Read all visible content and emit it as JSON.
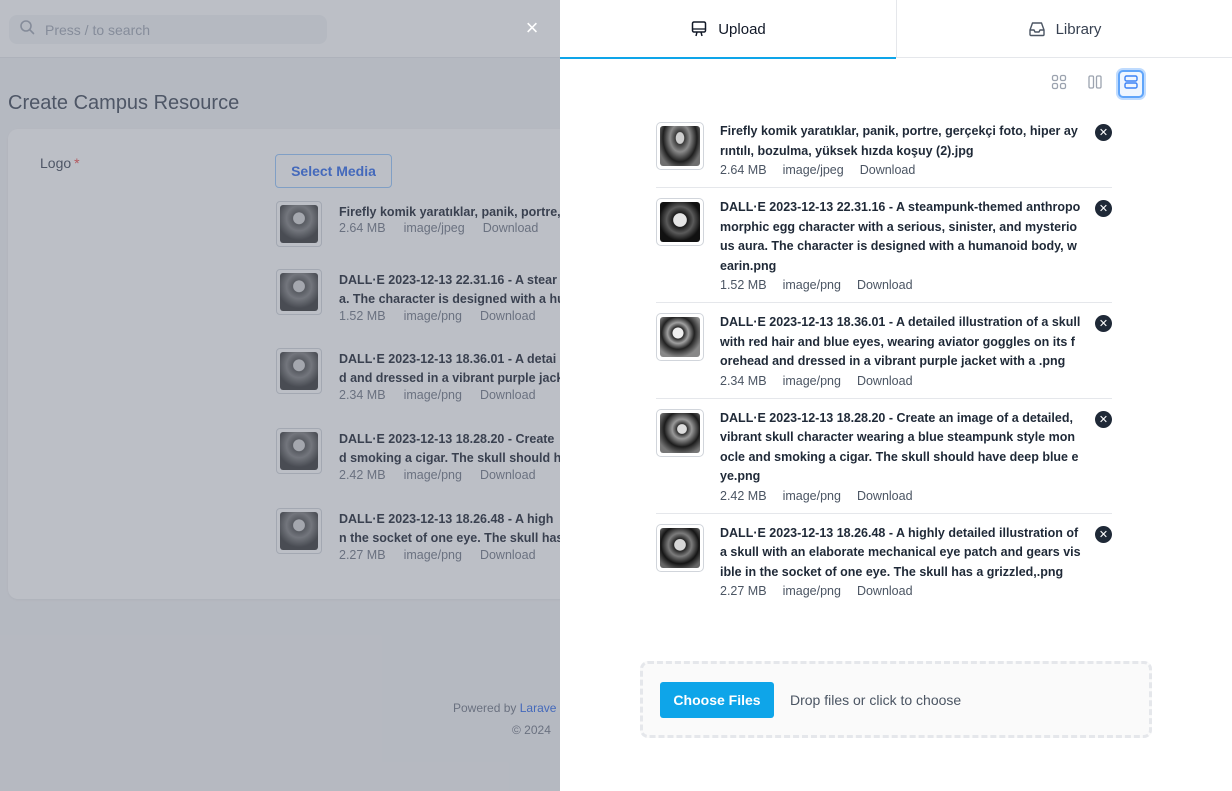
{
  "background": {
    "search_placeholder": "Press / to search",
    "close_label": "×",
    "page_title": "Create Campus Resource",
    "logo_label": "Logo",
    "required_mark": "*",
    "select_media_label": "Select Media",
    "items": [
      {
        "title_line1": "Firefly komik yaratıklar, panik, portre,",
        "title_line2": "",
        "size": "2.64 MB",
        "type": "image/jpeg",
        "download": "Download"
      },
      {
        "title_line1": "DALL·E 2023-12-13 22.31.16 - A stear",
        "title_line2": "a. The character is designed with a hu",
        "size": "1.52 MB",
        "type": "image/png",
        "download": "Download"
      },
      {
        "title_line1": "DALL·E 2023-12-13 18.36.01 - A detai",
        "title_line2": "d and dressed in a vibrant purple jack",
        "size": "2.34 MB",
        "type": "image/png",
        "download": "Download"
      },
      {
        "title_line1": "DALL·E 2023-12-13 18.28.20 - Create",
        "title_line2": "d smoking a cigar. The skull should ha",
        "size": "2.42 MB",
        "type": "image/png",
        "download": "Download"
      },
      {
        "title_line1": "DALL·E 2023-12-13 18.26.48 - A high",
        "title_line2": "n the socket of one eye. The skull has",
        "size": "2.27 MB",
        "type": "image/png",
        "download": "Download"
      }
    ],
    "footer_powered": "Powered by",
    "footer_link": "Larave",
    "footer_copyright": "© 2024"
  },
  "drawer": {
    "tabs": [
      {
        "label": "Upload",
        "icon": "monitor-icon",
        "active": true
      },
      {
        "label": "Library",
        "icon": "inbox-icon",
        "active": false
      }
    ],
    "view_modes": [
      "grid-view-icon",
      "columns-view-icon",
      "list-view-icon"
    ],
    "active_view": "list",
    "files": [
      {
        "name": "Firefly komik yaratıklar, panik, portre, gerçekçi foto, hiper ayrıntılı, bozulma, yüksek hızda koşuy (2).jpg",
        "size": "2.64 MB",
        "type": "image/jpeg",
        "download": "Download"
      },
      {
        "name": "DALL·E 2023-12-13 22.31.16 - A steampunk-themed anthropomorphic egg character with a serious, sinister, and mysterious aura. The character is designed with a humanoid body, wearin.png",
        "size": "1.52 MB",
        "type": "image/png",
        "download": "Download"
      },
      {
        "name": "DALL·E 2023-12-13 18.36.01 - A detailed illustration of a skull with red hair and blue eyes, wearing aviator goggles on its forehead and dressed in a vibrant purple jacket with a .png",
        "size": "2.34 MB",
        "type": "image/png",
        "download": "Download"
      },
      {
        "name": "DALL·E 2023-12-13 18.28.20 - Create an image of a detailed, vibrant skull character wearing a blue steampunk style monocle and smoking a cigar. The skull should have deep blue eye.png",
        "size": "2.42 MB",
        "type": "image/png",
        "download": "Download"
      },
      {
        "name": "DALL·E 2023-12-13 18.26.48 - A highly detailed illustration of a skull with an elaborate mechanical eye patch and gears visible in the socket of one eye. The skull has a grizzled,.png",
        "size": "2.27 MB",
        "type": "image/png",
        "download": "Download"
      }
    ],
    "choose_files_label": "Choose Files",
    "drop_text": "Drop files or click to choose",
    "colors": {
      "accent": "#0ea5e9",
      "active_view_border": "#60a5fa"
    }
  }
}
